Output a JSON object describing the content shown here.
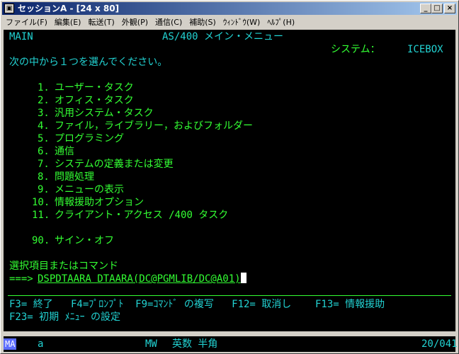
{
  "window": {
    "title": "セッションA - [24 x 80]",
    "icon": "terminal-session-icon",
    "controls": [
      "_",
      "□",
      "×"
    ]
  },
  "menu": [
    {
      "label": "ファイル(F)"
    },
    {
      "label": "編集(E)"
    },
    {
      "label": "転送(T)"
    },
    {
      "label": "外観(P)"
    },
    {
      "label": "通信(C)"
    },
    {
      "label": "補助(S)"
    },
    {
      "label": "ｳｨﾝﾄﾞｳ(W)"
    },
    {
      "label": "ﾍﾙﾌﾟ(H)"
    }
  ],
  "screen": {
    "menu_id": "MAIN",
    "title": "AS/400 メイン・メニュー",
    "system_label": "システム：",
    "system_name": "ICEBOX",
    "instruction": "次の中から１つを選んでください。",
    "options": [
      {
        "num": "1.",
        "label": "ユーザー・タスク"
      },
      {
        "num": "2.",
        "label": "オフィス・タスク"
      },
      {
        "num": "3.",
        "label": "汎用システム・タスク"
      },
      {
        "num": "4.",
        "label": "ファイル，ライブラリー，およびフォルダー"
      },
      {
        "num": "5.",
        "label": "プログラミング"
      },
      {
        "num": "6.",
        "label": "通信"
      },
      {
        "num": "7.",
        "label": "システムの定義または変更"
      },
      {
        "num": "8.",
        "label": "問題処理"
      },
      {
        "num": "9.",
        "label": "メニューの表示"
      },
      {
        "num": "10.",
        "label": "情報援助オプション"
      },
      {
        "num": "11.",
        "label": "クライアント・アクセス /400 タスク"
      },
      {
        "num": "90.",
        "label": "サイン・オフ"
      }
    ],
    "command_label": "選択項目またはコマンド",
    "command_prompt": "===>",
    "command_value": "DSPDTAARA DTAARA(DC@PGMLIB/DC@A01)",
    "fkeys_line1": "F3= 終了   F4=ﾌﾟﾛﾝﾌﾟﾄ  F9=ｺﾏﾝﾄﾞ の複写   F12= 取消し    F13= 情報援助",
    "fkeys_line2": "F23= 初期 ﾒﾆｭｰ の設定"
  },
  "statusbar": {
    "ma": "MA",
    "session": "a",
    "mw": "MW",
    "input_mode": "英数 半角",
    "cursor_pos": "20/041"
  }
}
